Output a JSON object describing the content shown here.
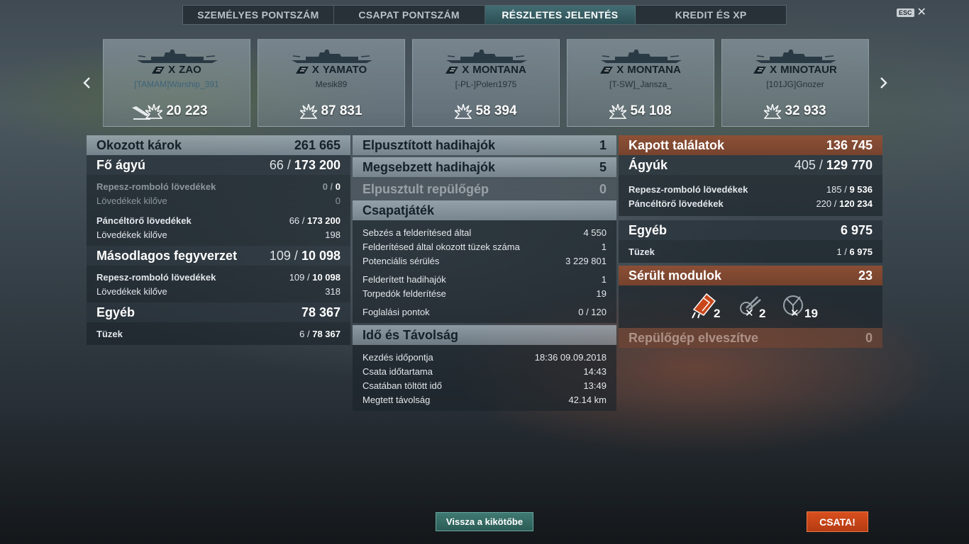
{
  "tabs": [
    {
      "label": "SZEMÉLYES PONTSZÁM",
      "active": false
    },
    {
      "label": "CSAPAT PONTSZÁM",
      "active": false
    },
    {
      "label": "RÉSZLETES JELENTÉS",
      "active": true
    },
    {
      "label": "KREDIT ÉS XP",
      "active": false
    }
  ],
  "esc": {
    "key": "ESC",
    "close": "✕"
  },
  "ships": [
    {
      "tier": "X",
      "name": "ZAO",
      "player": "[TAMAM]Warship_391",
      "score": "20 223",
      "sunk": true,
      "player_color": "#3d6478"
    },
    {
      "tier": "X",
      "name": "YAMATO",
      "player": "Mesik89",
      "score": "87 831",
      "sunk": false,
      "player_color": "#25323a"
    },
    {
      "tier": "X",
      "name": "MONTANA",
      "player": "[-PL-]Polen1975",
      "score": "58 394",
      "sunk": false,
      "player_color": "#25323a"
    },
    {
      "tier": "X",
      "name": "MONTANA",
      "player": "[T-SW]_Jansza_",
      "score": "54 108",
      "sunk": false,
      "player_color": "#25323a"
    },
    {
      "tier": "X",
      "name": "MINOTAUR",
      "player": "[101JG]Gnozer",
      "score": "32 933",
      "sunk": false,
      "player_color": "#25323a"
    }
  ],
  "left": {
    "damage": {
      "label": "Okozott károk",
      "value": "261 665"
    },
    "main": {
      "label": "Fő ágyú",
      "hits": "66",
      "total": "173 200"
    },
    "main_he": {
      "label": "Repesz-romboló lövedékek",
      "hits": "0",
      "total": "0"
    },
    "main_he_fired": {
      "label": "Lövedékek kilőve",
      "value": "0"
    },
    "main_ap": {
      "label": "Páncéltörő lövedékek",
      "hits": "66",
      "total": "173 200"
    },
    "main_ap_fired": {
      "label": "Lövedékek kilőve",
      "value": "198"
    },
    "secondary": {
      "label": "Másodlagos fegyverzet",
      "hits": "109",
      "total": "10 098"
    },
    "sec_he": {
      "label": "Repesz-romboló lövedékek",
      "hits": "109",
      "total": "10 098"
    },
    "sec_fired": {
      "label": "Lövedékek kilőve",
      "value": "318"
    },
    "other": {
      "label": "Egyéb",
      "value": "78 367"
    },
    "fires": {
      "label": "Tüzek",
      "hits": "6",
      "total": "78 367"
    }
  },
  "mid": {
    "destroyed": {
      "label": "Elpusztított hadihajók",
      "value": "1"
    },
    "damaged": {
      "label": "Megsebzett hadihajók",
      "value": "5"
    },
    "planes": {
      "label": "Elpusztult repülőgép",
      "value": "0"
    },
    "team": {
      "label": "Csapatjáték",
      "rows": [
        {
          "label": "Sebzés a felderítésed által",
          "value": "4 550"
        },
        {
          "label": "Felderítésed által okozott tüzek száma",
          "value": "1"
        },
        {
          "label": "Potenciális sérülés",
          "value": "3 229 801"
        },
        {
          "label": "Felderített hadihajók",
          "value": "1"
        },
        {
          "label": "Torpedók felderítése",
          "value": "19"
        },
        {
          "label": "Foglalási pontok",
          "value": "0 / 120"
        }
      ]
    },
    "time": {
      "label": "Idő és Távolság",
      "rows": [
        {
          "label": "Kezdés időpontja",
          "value": "18:36  09.09.2018"
        },
        {
          "label": "Csata időtartama",
          "value": "14:43"
        },
        {
          "label": "Csatában töltött idő",
          "value": "13:49"
        },
        {
          "label": "Megtett távolság",
          "value": "42.14 km"
        }
      ]
    }
  },
  "right": {
    "received": {
      "label": "Kapott találatok",
      "value": "136 745"
    },
    "guns": {
      "label": "Ágyúk",
      "hits": "405",
      "total": "129 770"
    },
    "he": {
      "label": "Repesz-romboló lövedékek",
      "hits": "185",
      "total": "9 536"
    },
    "ap": {
      "label": "Páncéltörő lövedékek",
      "hits": "220",
      "total": "120 234"
    },
    "other": {
      "label": "Egyéb",
      "value": "6 975"
    },
    "fires": {
      "label": "Tüzek",
      "hits": "1",
      "total": "6 975"
    },
    "modules": {
      "label": "Sérült modulok",
      "value": "23",
      "items": [
        {
          "icon": "damaged-engine-icon",
          "count": "2",
          "destroyed_mark": ""
        },
        {
          "icon": "destroyed-gun-icon",
          "count": "2",
          "destroyed_mark": "✕"
        },
        {
          "icon": "destroyed-aa-icon",
          "count": "19",
          "destroyed_mark": "✕"
        }
      ]
    },
    "planes_lost": {
      "label": "Repülőgép elveszítve",
      "value": "0"
    }
  },
  "buttons": {
    "port": "Vissza a kikötőbe",
    "battle": "CSATA!"
  },
  "colors": {
    "accent_teal": "#2c5c56",
    "battle_orange": "#c8461a",
    "received_header": "#8a4a30"
  }
}
